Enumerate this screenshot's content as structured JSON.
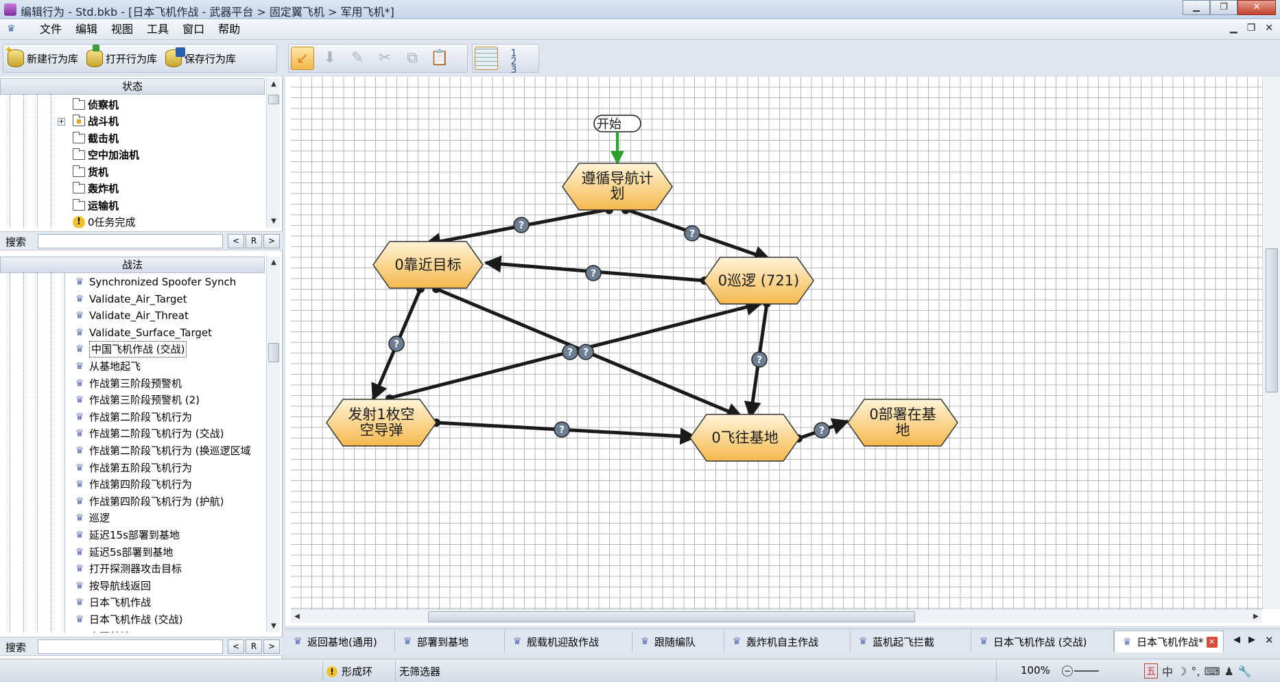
{
  "window": {
    "title": "编辑行为 - Std.bkb - [日本飞机作战 - 武器平台 > 固定翼飞机 > 军用飞机*]",
    "minimize": "▁",
    "maximize": "❐",
    "close": "✕"
  },
  "menu": {
    "items": [
      "文件",
      "编辑",
      "视图",
      "工具",
      "窗口",
      "帮助"
    ],
    "mdi_min": "▁",
    "mdi_restore": "❐",
    "mdi_close": "✕"
  },
  "toolbar": {
    "new_library": "新建行为库",
    "open_library": "打开行为库",
    "save_library": "保存行为库"
  },
  "state_panel": {
    "header": "状态",
    "items": [
      {
        "label": "侦察机",
        "type": "folder"
      },
      {
        "label": "战斗机",
        "type": "folder-locked"
      },
      {
        "label": "截击机",
        "type": "folder"
      },
      {
        "label": "空中加油机",
        "type": "folder"
      },
      {
        "label": "货机",
        "type": "folder"
      },
      {
        "label": "轰炸机",
        "type": "folder"
      },
      {
        "label": "运输机",
        "type": "folder"
      },
      {
        "label": "0任务完成",
        "type": "warning"
      }
    ],
    "search_label": "搜索",
    "search_value": "",
    "btn_prev": "<",
    "btn_reset": "R",
    "btn_next": ">"
  },
  "tactics_panel": {
    "header": "战法",
    "items": [
      "Synchronized Spoofer Synch",
      "Validate_Air_Target",
      "Validate_Air_Threat",
      "Validate_Surface_Target",
      "中国飞机作战 (交战)",
      "从基地起飞",
      "作战第三阶段预警机",
      "作战第三阶段预警机 (2)",
      "作战第二阶段飞机行为",
      "作战第二阶段飞机行为 (交战)",
      "作战第二阶段飞机行为 (换巡逻区域",
      "作战第五阶段飞机行为",
      "作战第四阶段飞机行为",
      "作战第四阶段飞机行为  (护航)",
      "巡逻",
      "延迟15s部署到基地",
      "延迟5s部署到基地",
      "打开探测器攻击目标",
      "按导航线返回",
      "日本飞机作战",
      "日本飞机作战 (交战)",
      "离开基地"
    ],
    "selected_index": 4,
    "search_label": "搜索",
    "search_value": "",
    "btn_prev": "<",
    "btn_reset": "R",
    "btn_next": ">"
  },
  "graph": {
    "start_label": "开始",
    "nodes": {
      "follow_nav": [
        "遵循导航计",
        "划"
      ],
      "approach": [
        "0靠近目标"
      ],
      "patrol": [
        "0巡逻 (721)"
      ],
      "launch": [
        "发射1枚空",
        "空导弹"
      ],
      "fly_base": [
        "0飞往基地"
      ],
      "deploy_base": [
        "0部署在基",
        "地"
      ]
    },
    "condition_marker": "?"
  },
  "tabs": {
    "items": [
      "返回基地(通用)",
      "部署到基地",
      "舰载机迎敌作战",
      "跟随编队",
      "轰炸机自主作战",
      "蓝机起飞拦截",
      "日本飞机作战 (交战)",
      "日本飞机作战*"
    ],
    "active_index": 7
  },
  "status": {
    "loop_warning": "形成环",
    "filter": "无筛选器",
    "zoom": "100%",
    "ime": [
      "五",
      "中",
      "☽",
      "°,",
      "⌨",
      "♟",
      "🔧"
    ]
  }
}
